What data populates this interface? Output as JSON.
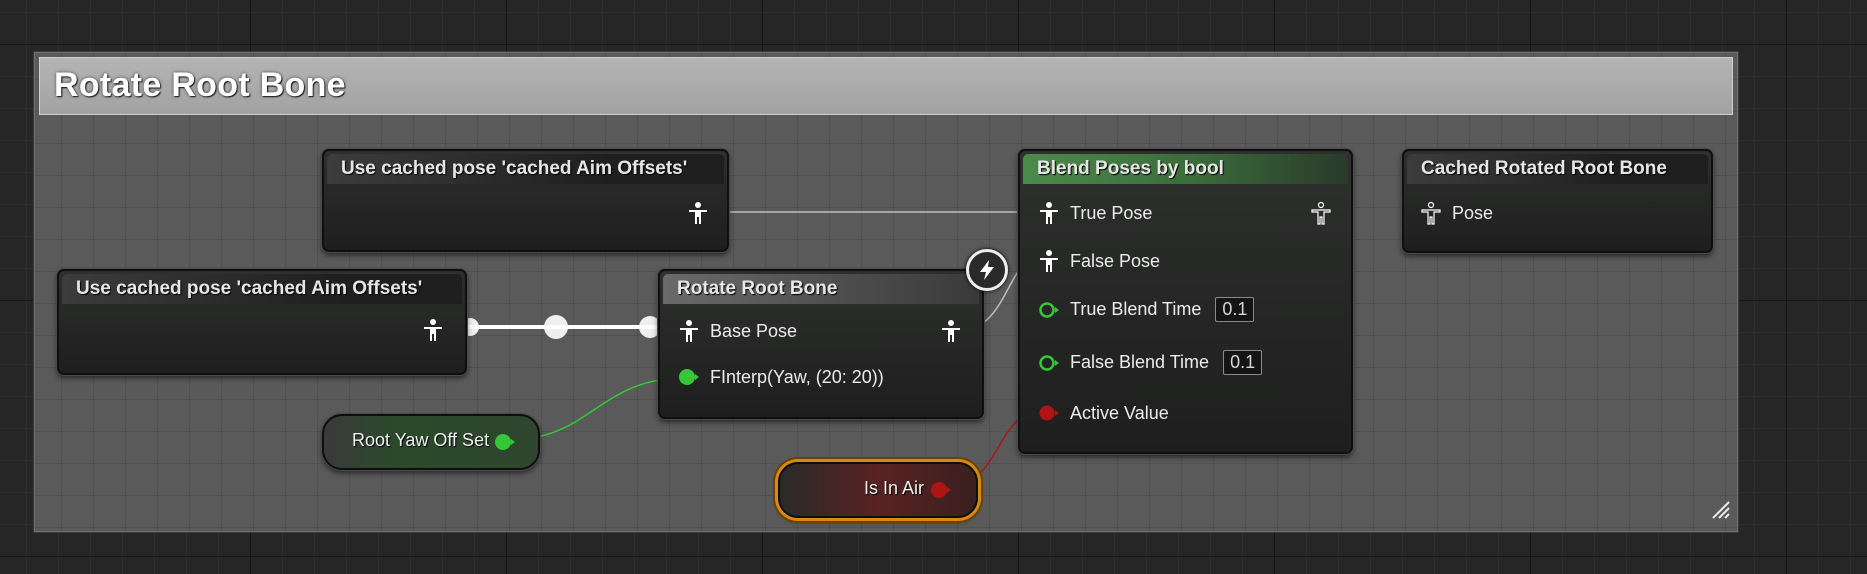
{
  "comment": {
    "title": "Rotate Root Bone"
  },
  "nodes": {
    "cached_pose_top": {
      "title": "Use cached pose 'cached Aim Offsets'"
    },
    "cached_pose_left": {
      "title": "Use cached pose 'cached Aim Offsets'"
    },
    "rotate_root_bone": {
      "title": "Rotate Root Bone",
      "pins": {
        "base_pose": "Base Pose",
        "yaw": "FInterp(Yaw, (20: 20))"
      }
    },
    "blend_poses": {
      "title": "Blend Poses by bool",
      "pins": {
        "true_pose": "True Pose",
        "false_pose": "False Pose",
        "true_blend_time": "True Blend Time",
        "true_blend_time_value": "0.1",
        "false_blend_time": "False Blend Time",
        "false_blend_time_value": "0.1",
        "active_value": "Active Value"
      }
    },
    "cached_rotated": {
      "title": "Cached Rotated Root Bone",
      "pins": {
        "pose": "Pose"
      }
    },
    "root_yaw_var": {
      "label": "Root Yaw Off Set"
    },
    "is_in_air_var": {
      "label": "Is In Air"
    }
  },
  "colors": {
    "pose_pin": "#ffffff",
    "float_pin": "#35c735",
    "bool_pin": "#b01414",
    "blend_header": "#4c8a4c",
    "selection": "#d88a10"
  },
  "icons": {
    "pose": "pose-person-icon",
    "fast_path": "lightning-bolt-icon",
    "resize": "resize-grip-icon"
  }
}
